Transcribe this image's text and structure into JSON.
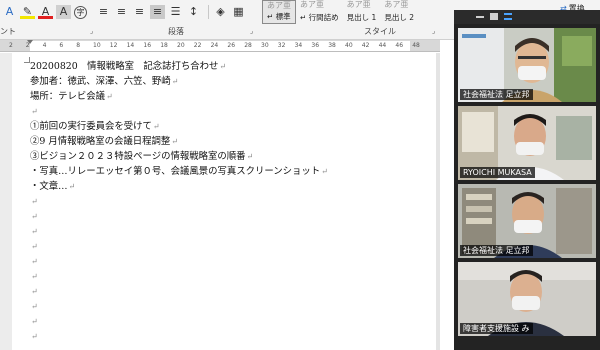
{
  "ribbon": {
    "font_group_label": "ント",
    "paragraph_group_label": "段落",
    "styles_group_label": "スタイル",
    "replace_label": "置換",
    "styles": [
      {
        "preview": "あア亜",
        "name": "↵ 標準",
        "selected": true
      },
      {
        "preview": "あア亜",
        "name": "↵ 行間詰め",
        "selected": false
      },
      {
        "preview": "あア亜",
        "name": "見出し 1",
        "selected": false
      },
      {
        "preview": "あア亜",
        "name": "見出し 2",
        "selected": false
      }
    ],
    "font_icons": [
      "text-effects-icon",
      "highlight-icon",
      "font-color-icon",
      "char-shading-icon",
      "enclose-char-icon"
    ],
    "paragraph_icons": [
      "align-left-icon",
      "align-center-icon",
      "align-right-icon",
      "justify-icon",
      "distributed-icon",
      "line-spacing-icon",
      "shading-icon",
      "border-icon"
    ]
  },
  "ruler": {
    "numbers": [
      "2",
      "2",
      "4",
      "6",
      "8",
      "10",
      "12",
      "14",
      "16",
      "18",
      "20",
      "22",
      "24",
      "26",
      "28",
      "30",
      "32",
      "34",
      "36",
      "38",
      "40",
      "42",
      "44",
      "46",
      "48"
    ]
  },
  "document": {
    "paragraph_mark": "↵",
    "lines": [
      "20200820　情報戦略室　記念誌打ち合わせ",
      "参加者：徳武、深澤、六笠、野崎",
      "場所：テレビ会議",
      "",
      "①前回の実行委員会を受けて",
      "②9 月情報戦略室の会議日程調整",
      "③ビジョン２０２３特設ページの情報戦略室の順番",
      "・写真…リレーエッセイ第０号、会議風景の写真スクリーンショット",
      "・文章…",
      "",
      "",
      "",
      "",
      "",
      "",
      "",
      "",
      "",
      ""
    ]
  },
  "zoom": {
    "accent_color": "#9ed33a",
    "participants": [
      {
        "name": "社会福祉法 足立邦",
        "active": false
      },
      {
        "name": "RYOICHI MUKASA",
        "active": true
      },
      {
        "name": "社会福祉法 足立邦",
        "active": false
      },
      {
        "name": "障害者支援施設 み",
        "active": false
      }
    ]
  }
}
